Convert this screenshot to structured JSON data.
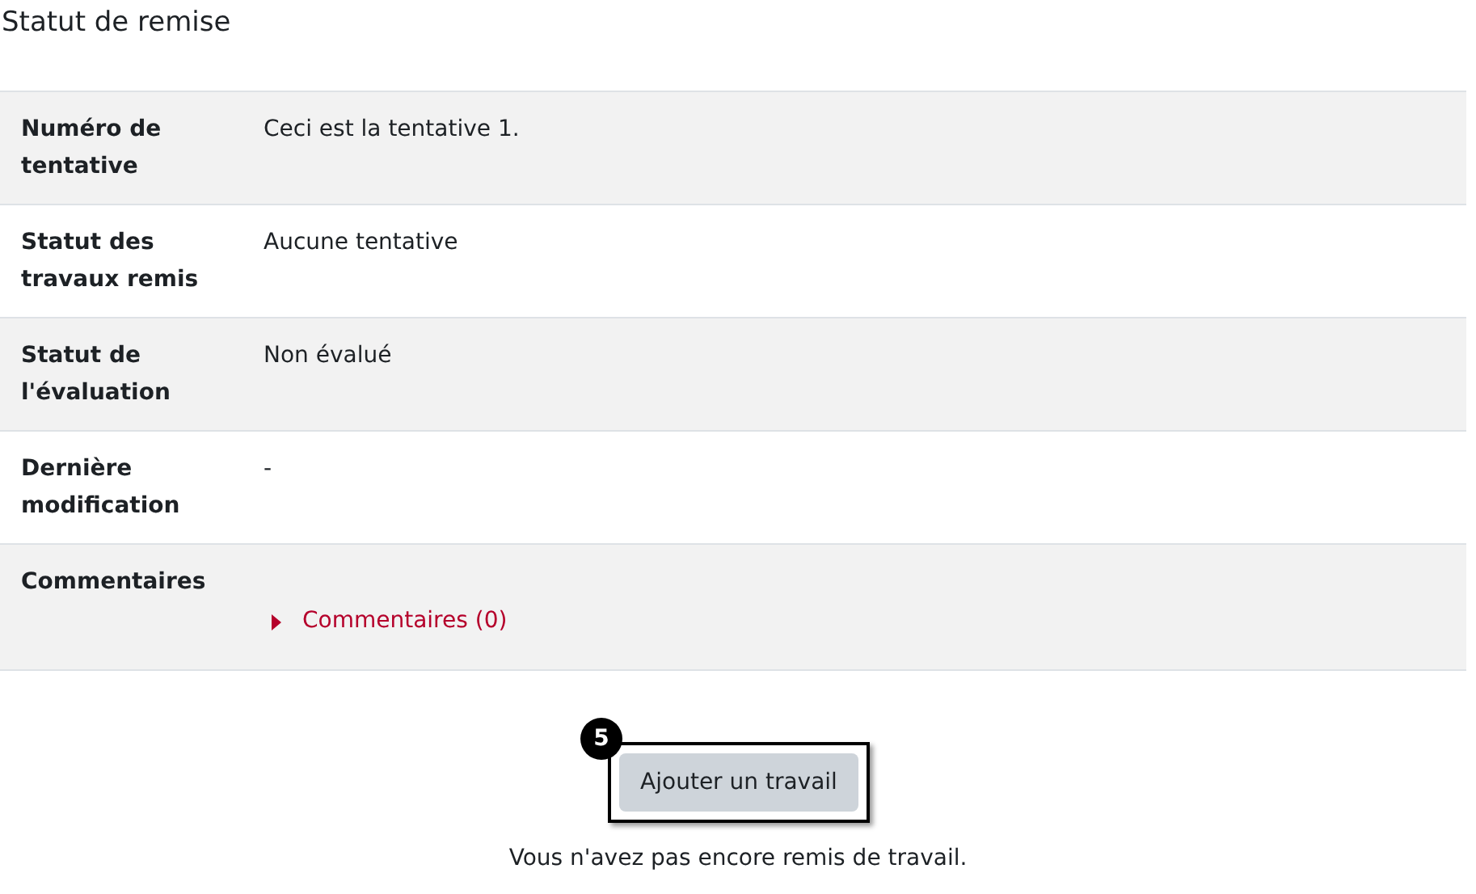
{
  "title": "Statut de remise",
  "rows": [
    {
      "label": "Numéro de tentative",
      "kind": "text",
      "value": "Ceci est la tentative 1."
    },
    {
      "label": "Statut des travaux remis",
      "kind": "text",
      "value": "Aucune tentative"
    },
    {
      "label": "Statut de l'évaluation",
      "kind": "text",
      "value": "Non évalué"
    },
    {
      "label": "Dernière modification",
      "kind": "text",
      "value": "-"
    },
    {
      "label": "Commentaires",
      "kind": "toggle",
      "value": "Commentaires (0)",
      "expanded": false
    }
  ],
  "callout": {
    "number": "5"
  },
  "button": "Ajouter un travail",
  "note": "Vous n'avez pas encore remis de travail."
}
